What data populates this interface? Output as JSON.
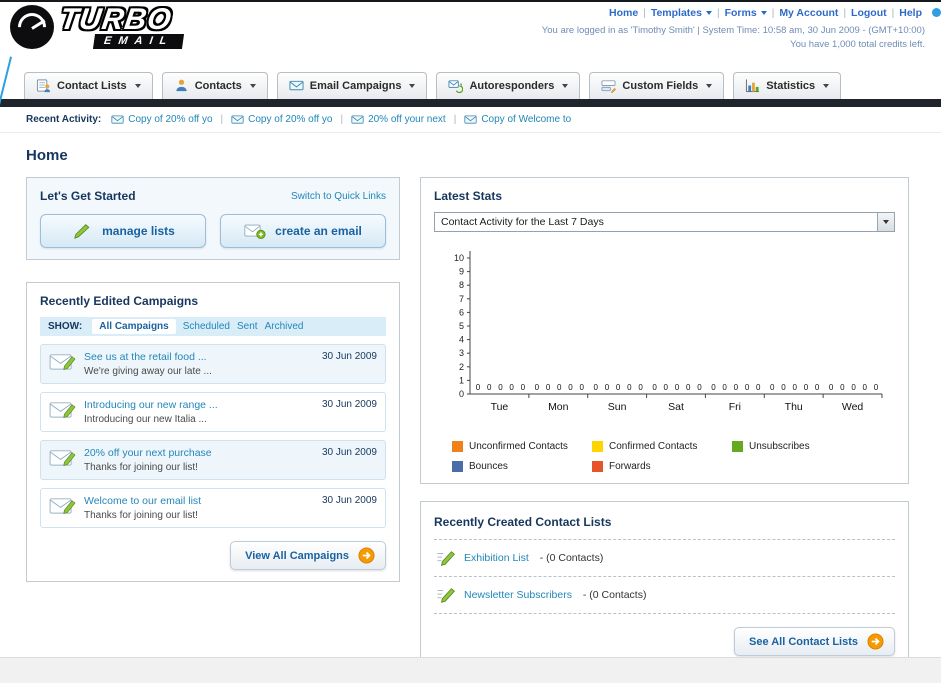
{
  "header": {
    "logo_line1": "TURBO",
    "logo_line2": "EMAIL",
    "nav": [
      {
        "label": "Home",
        "dropdown": false
      },
      {
        "label": "Templates",
        "dropdown": true
      },
      {
        "label": "Forms",
        "dropdown": true
      },
      {
        "label": "My Account",
        "dropdown": false
      },
      {
        "label": "Logout",
        "dropdown": false
      },
      {
        "label": "Help",
        "dropdown": false
      }
    ],
    "login_info": "You are logged in as 'Timothy Smith' | System Time: 10:58 am, 30 Jun 2009 - (GMT+10:00)",
    "credits_info": "You have 1,000 total credits left."
  },
  "tabs": [
    {
      "label": "Contact Lists",
      "icon": "contact-lists-icon"
    },
    {
      "label": "Contacts",
      "icon": "contacts-icon"
    },
    {
      "label": "Email Campaigns",
      "icon": "email-campaigns-icon"
    },
    {
      "label": "Autoresponders",
      "icon": "autoresponders-icon"
    },
    {
      "label": "Custom Fields",
      "icon": "custom-fields-icon"
    },
    {
      "label": "Statistics",
      "icon": "statistics-icon"
    }
  ],
  "recent_activity": {
    "label": "Recent Activity:",
    "items": [
      "Copy of 20% off yo",
      "Copy of 20% off yo",
      "20% off your next",
      "Copy of Welcome to"
    ]
  },
  "page": {
    "title": "Home"
  },
  "get_started": {
    "title": "Let's Get Started",
    "switch_link": "Switch to Quick Links",
    "manage_lists_label": "manage lists",
    "create_email_label": "create an email"
  },
  "campaigns": {
    "title": "Recently Edited Campaigns",
    "show_label": "SHOW:",
    "filters": [
      "All Campaigns",
      "Scheduled",
      "Sent",
      "Archived"
    ],
    "selected_filter": "All Campaigns",
    "items": [
      {
        "title": "See us at the retail food ...",
        "subtitle": "We're giving away our late ...",
        "date": "30 Jun 2009"
      },
      {
        "title": "Introducing our new range ...",
        "subtitle": "Introducing our new Italia ...",
        "date": "30 Jun 2009"
      },
      {
        "title": "20% off your next purchase",
        "subtitle": "Thanks for joining our list!",
        "date": "30 Jun 2009"
      },
      {
        "title": "Welcome to our email list",
        "subtitle": "Thanks for joining our list!",
        "date": "30 Jun 2009"
      }
    ],
    "view_all_label": "View All Campaigns"
  },
  "stats": {
    "title": "Latest Stats",
    "filter_value": "Contact Activity for the Last 7 Days",
    "legend": [
      {
        "label": "Unconfirmed Contacts",
        "color": "#f08019"
      },
      {
        "label": "Confirmed Contacts",
        "color": "#ffd400"
      },
      {
        "label": "Unsubscribes",
        "color": "#67a821"
      },
      {
        "label": "Bounces",
        "color": "#4a6da8"
      },
      {
        "label": "Forwards",
        "color": "#e5552a"
      }
    ]
  },
  "chart_data": {
    "type": "bar",
    "title": "Contact Activity for the Last 7 Days",
    "categories": [
      "Tue",
      "Mon",
      "Sun",
      "Sat",
      "Fri",
      "Thu",
      "Wed"
    ],
    "series": [
      {
        "name": "Unconfirmed Contacts",
        "values": [
          0,
          0,
          0,
          0,
          0,
          0,
          0
        ]
      },
      {
        "name": "Confirmed Contacts",
        "values": [
          0,
          0,
          0,
          0,
          0,
          0,
          0
        ]
      },
      {
        "name": "Unsubscribes",
        "values": [
          0,
          0,
          0,
          0,
          0,
          0,
          0
        ]
      },
      {
        "name": "Bounces",
        "values": [
          0,
          0,
          0,
          0,
          0,
          0,
          0
        ]
      },
      {
        "name": "Forwards",
        "values": [
          0,
          0,
          0,
          0,
          0,
          0,
          0
        ]
      }
    ],
    "ylim": [
      0,
      10
    ],
    "yticks": [
      0,
      1,
      2,
      3,
      4,
      5,
      6,
      7,
      8,
      9,
      10
    ],
    "grid": false,
    "legend_position": "bottom"
  },
  "contact_lists": {
    "title": "Recently Created Contact Lists",
    "items": [
      {
        "name": "Exhibition List",
        "detail": "- (0 Contacts)"
      },
      {
        "name": "Newsletter Subscribers",
        "detail": "- (0 Contacts)"
      }
    ],
    "see_all_label": "See All Contact Lists"
  }
}
